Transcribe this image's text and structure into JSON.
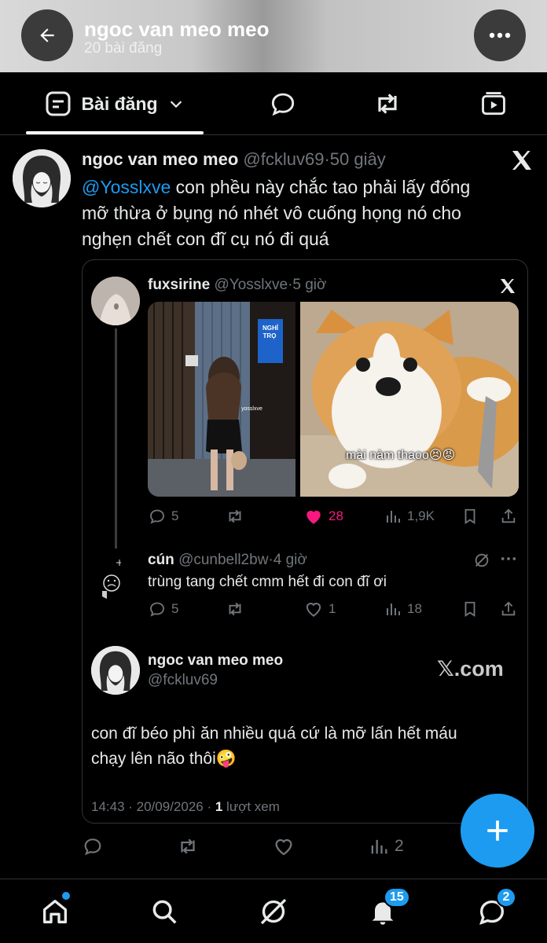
{
  "header": {
    "title": "ngoc van meo meo",
    "subtitle": "20 bài đăng"
  },
  "tabs": {
    "active_label": "Bài đăng"
  },
  "post": {
    "author_name": "ngoc van meo meo",
    "handle": "@fckluv69",
    "separator": "·",
    "time": "50 giây",
    "mention": "@Yosslxve",
    "text_line1": " con phều này chắc tao phải lấy đống",
    "text_line2": "mỡ thừa ở bụng nó nhét vô cuống họng nó cho",
    "text_line3": "nghẹn chết con đĩ cụ nó đi quá",
    "actions": {
      "views": "2"
    }
  },
  "embed": {
    "quoted": {
      "author_name": "fuxsirine",
      "handle": "@Yosslxve",
      "separator": "·",
      "time": "5 giờ",
      "image1_caption": "NGHỈ TRỌ",
      "image1_small": "yosslxve",
      "image2_caption": "mài nàm thaoo😣😡",
      "stats": {
        "replies": "5",
        "likes": "28",
        "views": "1,9K"
      }
    },
    "reply": {
      "author_name": "cún",
      "handle": "@cunbell2bw",
      "separator": "·",
      "time": "4 giờ",
      "text": "trùng tang chết cmm hết đi con đĩ ơi",
      "stats": {
        "replies": "5",
        "likes": "1",
        "views": "18"
      }
    },
    "self": {
      "author_name": "ngoc van meo meo",
      "handle": "@fckluv69",
      "brand": "𝕏.com",
      "text_line1": "con đĩ béo phì ăn nhiều quá cứ là mỡ lấn hết máu",
      "text_line2": "chạy lên não thôi🤪",
      "meta_time": "14:43 · 20/09/2026 · ",
      "meta_views_count": "1",
      "meta_views_label": " lượt xem"
    }
  },
  "nav": {
    "notifications_badge": "15",
    "messages_badge": "2"
  },
  "colors": {
    "accent": "#1d9bf0",
    "like": "#f91880",
    "muted": "#71767b"
  }
}
